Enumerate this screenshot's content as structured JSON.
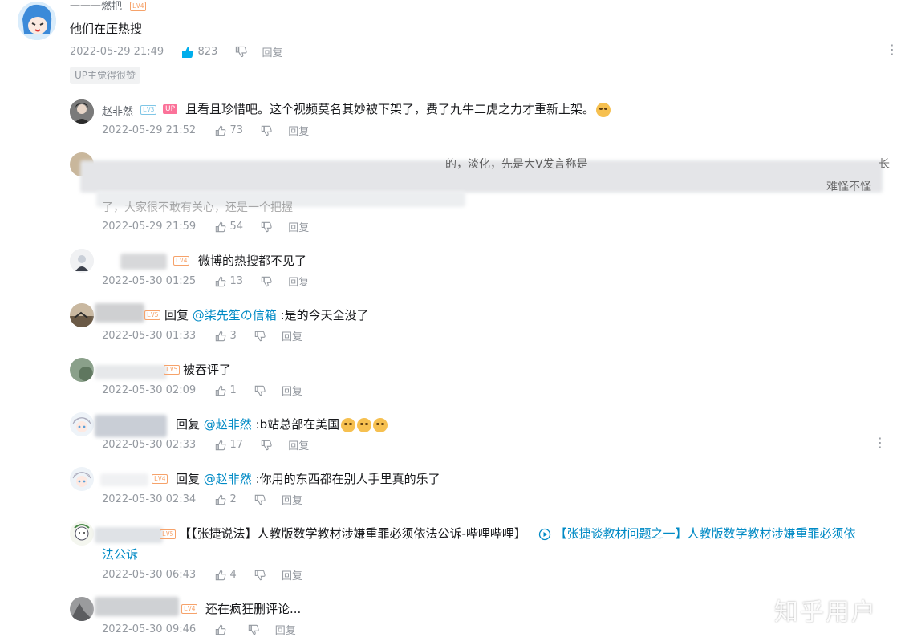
{
  "thread": {
    "root": {
      "username": "一一一燃把",
      "level": "LV4",
      "text": "他们在压热搜",
      "time": "2022-05-29 21:49",
      "likes": "823",
      "reply_label": "回复",
      "up_badge": "UP主觉得很赞"
    },
    "replies": [
      {
        "username": "赵非然",
        "level": "LV3",
        "up_tag": "UP",
        "text": "且看且珍惜吧。这个视频莫名其妙被下架了，费了九牛二虎之力才重新上架。",
        "time": "2022-05-29 21:52",
        "likes": "73",
        "reply_label": "回复"
      },
      {
        "line1": "的，淡化，先是大V发言称是",
        "line1_end": "长",
        "line2_end": "难怪不怪",
        "line3": "了，大家很不敢有关心，还是一个把握",
        "time": "2022-05-29 21:59",
        "likes": "54",
        "reply_label": "回复"
      },
      {
        "level": "LV4",
        "text": "微博的热搜都不见了",
        "time": "2022-05-30 01:25",
        "likes": "13",
        "reply_label": "回复"
      },
      {
        "level": "LV5",
        "prefix": "回复",
        "mention": "@柒先笙の信箱",
        "text": ":是的今天全没了",
        "time": "2022-05-30 01:33",
        "likes": "3",
        "reply_label": "回复"
      },
      {
        "level": "LV5",
        "text": "被吞评了",
        "time": "2022-05-30 02:09",
        "likes": "1",
        "reply_label": "回复"
      },
      {
        "prefix": "回复",
        "mention": "@赵非然",
        "text": ":b站总部在美国",
        "time": "2022-05-30 02:33",
        "likes": "17",
        "reply_label": "回复"
      },
      {
        "level": "LV4",
        "prefix": "回复",
        "mention": "@赵非然",
        "text": ":你用的东西都在别人手里真的乐了",
        "time": "2022-05-30 02:34",
        "likes": "2",
        "reply_label": "回复"
      },
      {
        "level": "LV5",
        "text": "【【张捷说法】人教版数学教材涉嫌重罪必须依法公诉-哔哩哔哩】",
        "link_text": "【张捷谈教材问题之一】人教版数学教材涉嫌重罪必须依",
        "link_text2": "法公诉",
        "time": "2022-05-30 06:43",
        "likes": "4",
        "reply_label": "回复"
      },
      {
        "level": "LV4",
        "text": "还在疯狂删评论...",
        "time": "2022-05-30 09:46",
        "likes": "",
        "reply_label": "回复"
      }
    ]
  },
  "watermark": "知乎用户",
  "colors": {
    "link": "#008ac5",
    "meta": "#9499a0",
    "level": "#f6a26a",
    "up_pink": "#fb7299",
    "like_blue": "#00aeec"
  },
  "icons": {
    "like": "thumbs-up-icon",
    "dislike": "thumbs-down-icon",
    "more": "more-vertical-icon",
    "video": "video-play-icon"
  }
}
